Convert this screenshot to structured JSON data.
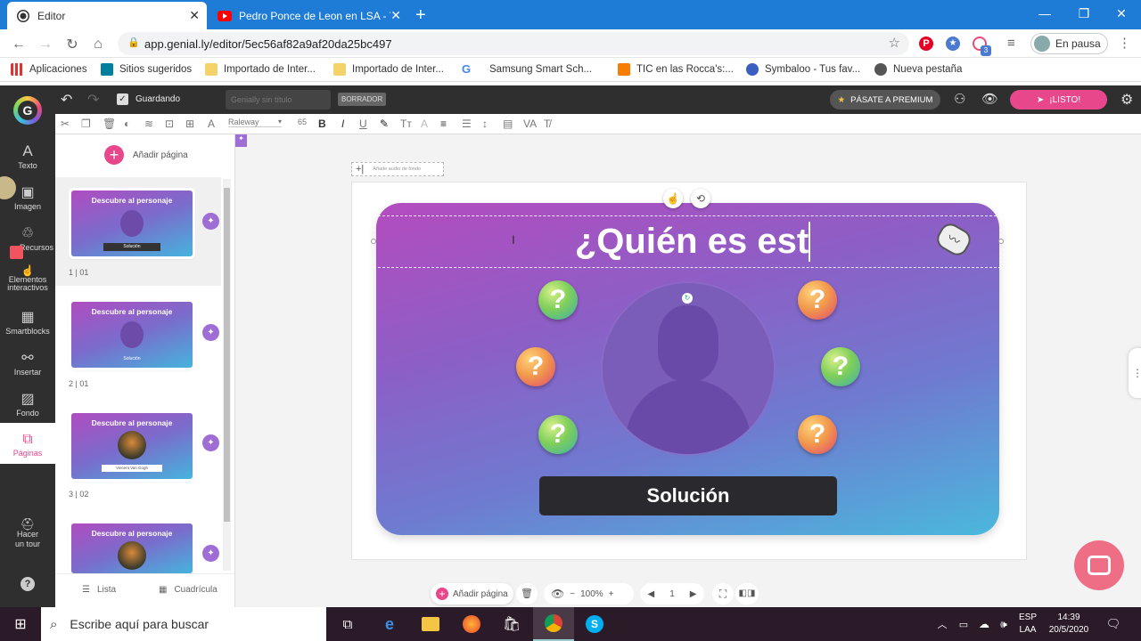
{
  "browser": {
    "tabs": [
      {
        "title": "Editor",
        "active": true
      },
      {
        "title": "Pedro Ponce de Leon en LSA - Yo",
        "active": false
      }
    ],
    "url": "app.genial.ly/editor/5ec56af82a9af20da25bc497",
    "profile_label": "En pausa",
    "extension_badge": "3"
  },
  "bookmarks": [
    {
      "label": "Aplicaciones",
      "icon": "apps-grid-icon"
    },
    {
      "label": "Sitios sugeridos",
      "icon": "bing-icon"
    },
    {
      "label": "Importado de Inter...",
      "icon": "folder-icon"
    },
    {
      "label": "Importado de Inter...",
      "icon": "folder-icon"
    },
    {
      "label": "Samsung Smart Sch...",
      "icon": "google-icon"
    },
    {
      "label": "TIC en las Rocca's:...",
      "icon": "blogger-icon"
    },
    {
      "label": "Symbaloo - Tus fav...",
      "icon": "symbaloo-icon"
    },
    {
      "label": "Nueva pestaña",
      "icon": "globe-icon"
    }
  ],
  "toolbar": {
    "status": "Guardando",
    "title_placeholder": "Genially sin título",
    "draft_badge": "BORRADOR",
    "premium": "PÁSATE A PREMIUM",
    "ready": "¡LISTO!",
    "font_name": "Raleway",
    "font_size": "65"
  },
  "sidebar": {
    "items": [
      {
        "label": "Texto",
        "icon": "text-icon"
      },
      {
        "label": "Imagen",
        "icon": "image-icon"
      },
      {
        "label": "Recursos",
        "icon": "resources-icon"
      },
      {
        "label": "Elementos interactivos",
        "icon": "interactive-icon"
      },
      {
        "label": "Smartblocks",
        "icon": "smartblocks-icon"
      },
      {
        "label": "Insertar",
        "icon": "insert-icon"
      },
      {
        "label": "Fondo",
        "icon": "background-icon"
      },
      {
        "label": "Páginas",
        "icon": "pages-icon"
      },
      {
        "label": "Hacer un tour",
        "icon": "tour-icon"
      }
    ]
  },
  "pages_panel": {
    "add_page": "Añadir página",
    "pages": [
      {
        "thumb_title": "Descubre al personaje",
        "number": "1 | 01",
        "thumb_button": "Solución"
      },
      {
        "thumb_title": "Descubre al personaje",
        "number": "2 | 01",
        "thumb_button": "Solución"
      },
      {
        "thumb_title": "Descubre al personaje",
        "number": "3 | 02",
        "thumb_button": "Vincent Van Gogh"
      },
      {
        "thumb_title": "Descubre al personaje",
        "number": "",
        "thumb_button": ""
      }
    ],
    "view_list": "Lista",
    "view_grid": "Cuadrícula"
  },
  "canvas": {
    "audio_label": "Añade audio de fondo",
    "title_text": "¿Quién es est",
    "question_mark": "?",
    "solution_button": "Solución"
  },
  "bottom_bar": {
    "add_page": "Añadir página",
    "zoom": "100%",
    "page_number": "1"
  },
  "taskbar": {
    "search_placeholder": "Escribe aquí para buscar",
    "lang_top": "ESP",
    "lang_bottom": "LAA",
    "time": "14:39",
    "date": "20/5/2020"
  },
  "colors": {
    "accent_pink": "#e8478b",
    "chrome_blue": "#1f7cd6",
    "editor_dark": "#2f2f2f"
  }
}
